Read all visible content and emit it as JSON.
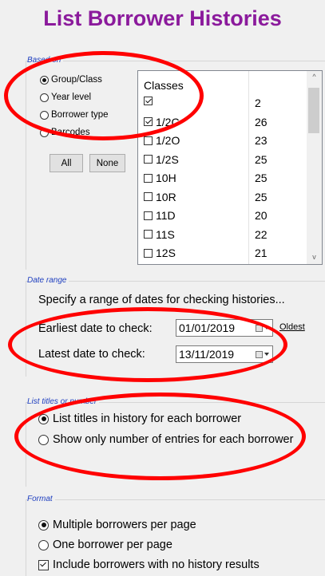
{
  "title": "List Borrower Histories",
  "based_on": {
    "legend": "Based on",
    "options": [
      "Group/Class",
      "Year level",
      "Borrower type",
      "Barcodes"
    ],
    "selected": 0,
    "all_label": "All",
    "none_label": "None"
  },
  "classes": {
    "header": "Classes",
    "rows": [
      {
        "name": "",
        "count": "2",
        "checked": true
      },
      {
        "name": "1/2C",
        "count": "26",
        "checked": true
      },
      {
        "name": "1/2O",
        "count": "23",
        "checked": false
      },
      {
        "name": "1/2S",
        "count": "25",
        "checked": false
      },
      {
        "name": "10H",
        "count": "25",
        "checked": false
      },
      {
        "name": "10R",
        "count": "25",
        "checked": false
      },
      {
        "name": "11D",
        "count": "20",
        "checked": false
      },
      {
        "name": "11S",
        "count": "22",
        "checked": false
      },
      {
        "name": "12S",
        "count": "21",
        "checked": false
      }
    ]
  },
  "date_range": {
    "legend": "Date range",
    "description": "Specify a range of dates for checking histories...",
    "earliest_label": "Earliest date to check:",
    "earliest_value": "01/01/2019",
    "latest_label": "Latest date to check:",
    "latest_value": "13/11/2019",
    "oldest_link": "Oldest"
  },
  "list_titles": {
    "legend": "List titles or number",
    "options": [
      "List titles in history for each borrower",
      "Show only number of entries for each borrower"
    ],
    "selected": 0
  },
  "format": {
    "legend": "Format",
    "options": [
      "Multiple borrowers per page",
      "One borrower per page"
    ],
    "selected": 0,
    "include_label": "Include borrowers with no history results",
    "include_checked": true
  },
  "annotation_color": "#ff0000",
  "title_color": "#8b1a9c",
  "legend_color": "#1f3fbf"
}
